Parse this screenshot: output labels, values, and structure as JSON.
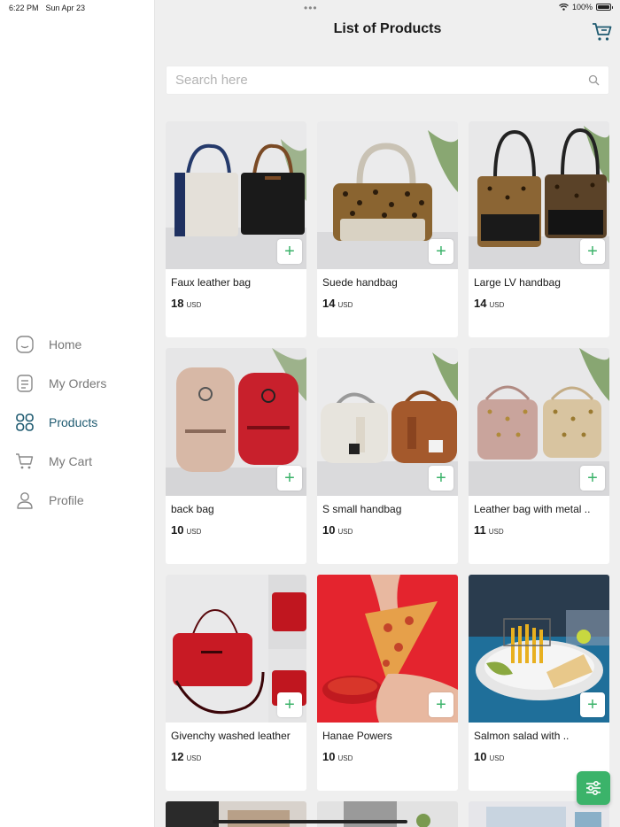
{
  "status": {
    "time": "6:22 PM",
    "date": "Sun Apr 23",
    "battery": "100%"
  },
  "header": {
    "title": "List of Products"
  },
  "search": {
    "placeholder": "Search here"
  },
  "nav": [
    {
      "label": "Home",
      "icon": "home-icon"
    },
    {
      "label": "My Orders",
      "icon": "orders-icon"
    },
    {
      "label": "Products",
      "icon": "grid-icon",
      "active": true
    },
    {
      "label": "My Cart",
      "icon": "cart-icon"
    },
    {
      "label": "Profile",
      "icon": "profile-icon"
    }
  ],
  "products": [
    {
      "name": "Faux leather bag",
      "price": "18",
      "currency": "USD"
    },
    {
      "name": "Suede handbag",
      "price": "14",
      "currency": "USD"
    },
    {
      "name": "Large LV handbag",
      "price": "14",
      "currency": "USD"
    },
    {
      "name": "back bag",
      "price": "10",
      "currency": "USD"
    },
    {
      "name": "S small handbag",
      "price": "10",
      "currency": "USD"
    },
    {
      "name": "Leather bag with metal ..",
      "price": "11",
      "currency": "USD"
    },
    {
      "name": "Givenchy washed leather",
      "price": "12",
      "currency": "USD"
    },
    {
      "name": "Hanae Powers",
      "price": "10",
      "currency": "USD"
    },
    {
      "name": "Salmon salad with ..",
      "price": "10",
      "currency": "USD"
    }
  ],
  "colors": {
    "accent": "#3bb36a",
    "nav_active": "#1e5a70"
  }
}
